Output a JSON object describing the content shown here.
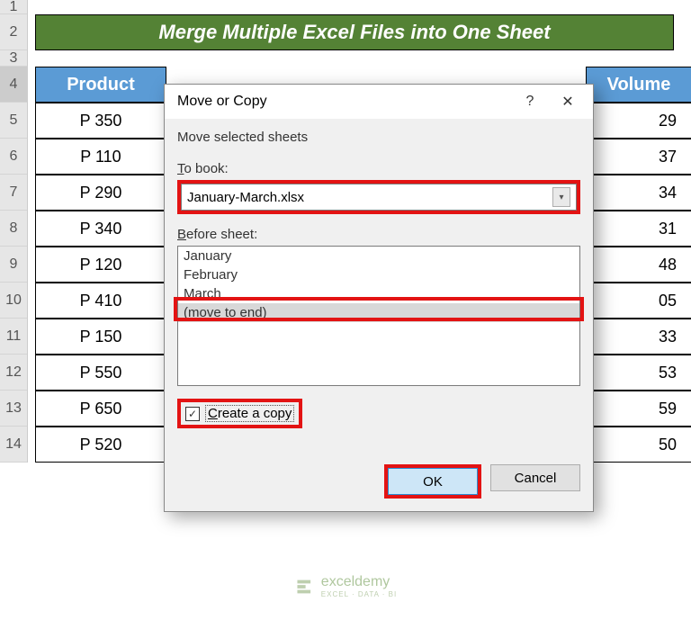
{
  "title_banner": "Merge Multiple Excel Files into One Sheet",
  "row_numbers": [
    "1",
    "2",
    "3",
    "4",
    "5",
    "6",
    "7",
    "8",
    "9",
    "10",
    "11",
    "12",
    "13",
    "14"
  ],
  "headers": {
    "col_a": "Product",
    "col_e": "Volume"
  },
  "rows": [
    {
      "a": "P 350",
      "e": "29"
    },
    {
      "a": "P 110",
      "e": "37"
    },
    {
      "a": "P 290",
      "e": "34"
    },
    {
      "a": "P 340",
      "e": "31"
    },
    {
      "a": "P 120",
      "e": "48"
    },
    {
      "a": "P 410",
      "e": "05"
    },
    {
      "a": "P 150",
      "e": "33"
    },
    {
      "a": "P 550",
      "e": "53"
    },
    {
      "a": "P 650",
      "e": "59"
    },
    {
      "a": "P 520",
      "e": "50"
    }
  ],
  "dialog": {
    "title": "Move or Copy",
    "help": "?",
    "close": "✕",
    "instruction": "Move selected sheets",
    "to_book_label": "To book:",
    "to_book_value": "January-March.xlsx",
    "before_sheet_label": "Before sheet:",
    "sheet_options": [
      "January",
      "February",
      "March",
      "(move to end)"
    ],
    "selected_option": "(move to end)",
    "create_copy_label": "Create a copy",
    "create_copy_checked": true,
    "ok": "OK",
    "cancel": "Cancel"
  },
  "watermark": {
    "brand": "exceldemy",
    "sub": "EXCEL · DATA · BI"
  }
}
